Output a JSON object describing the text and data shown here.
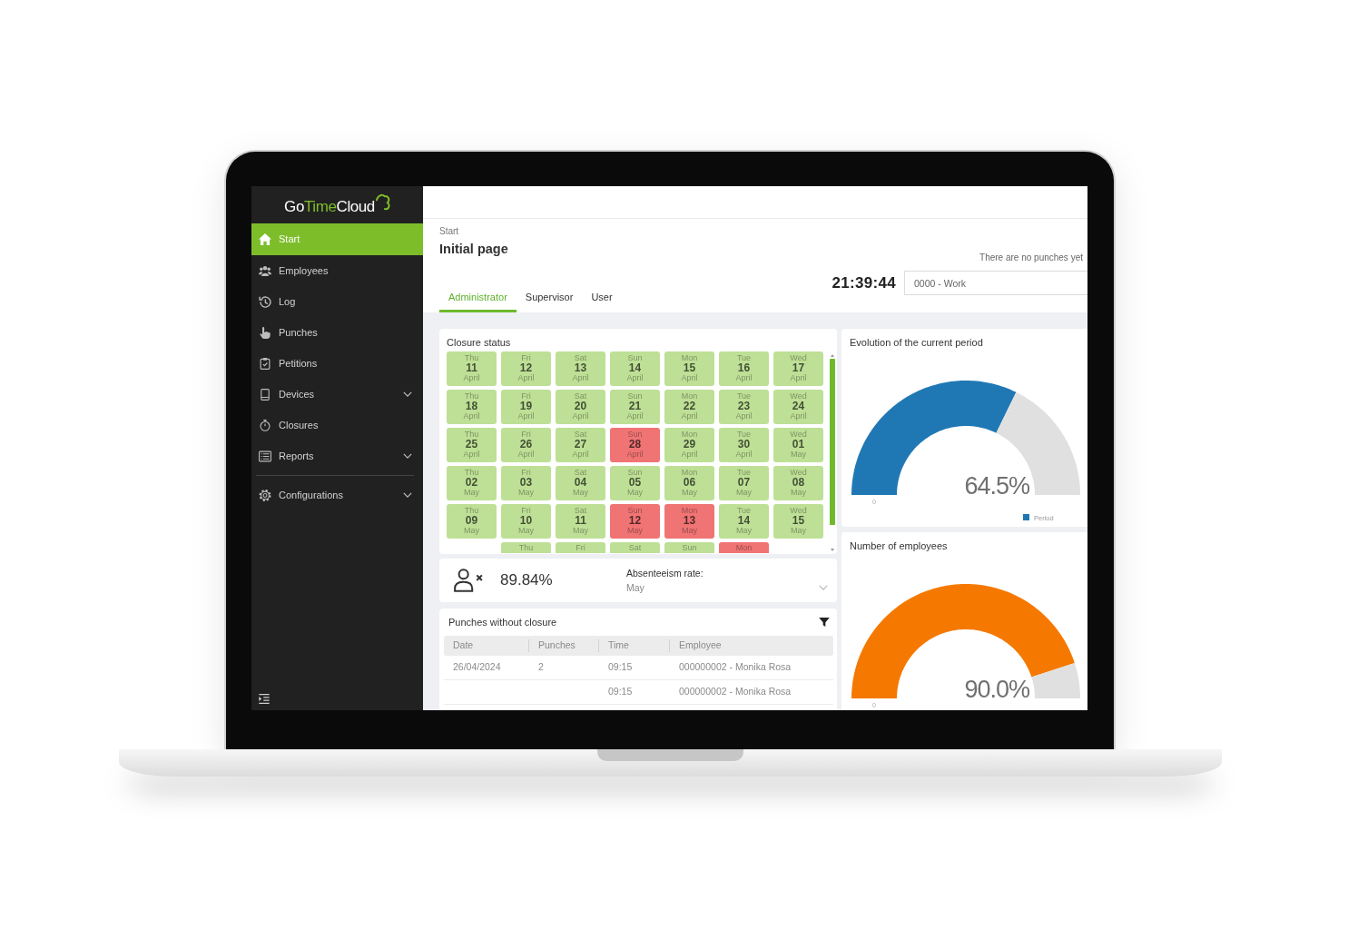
{
  "sidebar": {
    "logo": [
      {
        "text": "Go",
        "accent": false
      },
      {
        "text": "Time",
        "accent": true
      },
      {
        "text": "Cloud",
        "accent": false
      }
    ],
    "sections": [
      {
        "items": [
          {
            "label": "Start",
            "selected": true,
            "submenu": false
          },
          {
            "label": "Employees",
            "selected": false,
            "submenu": false
          },
          {
            "label": "Log",
            "selected": false,
            "submenu": false
          },
          {
            "label": "Punches",
            "selected": false,
            "submenu": false
          },
          {
            "label": "Petitions",
            "selected": false,
            "submenu": false
          },
          {
            "label": "Devices",
            "selected": false,
            "submenu": true
          },
          {
            "label": "Closures",
            "selected": false,
            "submenu": false
          },
          {
            "label": "Reports",
            "selected": false,
            "submenu": true
          }
        ]
      },
      {
        "items": [
          {
            "label": "Configurations",
            "selected": false,
            "submenu": true
          }
        ]
      }
    ]
  },
  "header": {
    "breadcrumb": "Start",
    "title": "Initial page",
    "punch_note": "There are no punches yet",
    "clock": "21:39:44",
    "activity_field": {
      "value": "0000 - Work"
    },
    "tabs": [
      {
        "label": "Administrator",
        "selected": true
      },
      {
        "label": "Supervisor",
        "selected": false
      },
      {
        "label": "User",
        "selected": false
      }
    ]
  },
  "closure_status": {
    "title": "Closure status",
    "days": [
      {
        "weekday": "Thu",
        "day": "11",
        "month": "April",
        "color": "#bee096"
      },
      {
        "weekday": "Fri",
        "day": "12",
        "month": "April",
        "color": "#bee096"
      },
      {
        "weekday": "Sat",
        "day": "13",
        "month": "April",
        "color": "#bee096"
      },
      {
        "weekday": "Sun",
        "day": "14",
        "month": "April",
        "color": "#bee096"
      },
      {
        "weekday": "Mon",
        "day": "15",
        "month": "April",
        "color": "#bee096"
      },
      {
        "weekday": "Tue",
        "day": "16",
        "month": "April",
        "color": "#bee096"
      },
      {
        "weekday": "Wed",
        "day": "17",
        "month": "April",
        "color": "#bee096"
      },
      {
        "weekday": "Thu",
        "day": "18",
        "month": "April",
        "color": "#bee096"
      },
      {
        "weekday": "Fri",
        "day": "19",
        "month": "April",
        "color": "#bee096"
      },
      {
        "weekday": "Sat",
        "day": "20",
        "month": "April",
        "color": "#bee096"
      },
      {
        "weekday": "Sun",
        "day": "21",
        "month": "April",
        "color": "#bee096"
      },
      {
        "weekday": "Mon",
        "day": "22",
        "month": "April",
        "color": "#bee096"
      },
      {
        "weekday": "Tue",
        "day": "23",
        "month": "April",
        "color": "#bee096"
      },
      {
        "weekday": "Wed",
        "day": "24",
        "month": "April",
        "color": "#bee096"
      },
      {
        "weekday": "Thu",
        "day": "25",
        "month": "April",
        "color": "#bee096"
      },
      {
        "weekday": "Fri",
        "day": "26",
        "month": "April",
        "color": "#bee096"
      },
      {
        "weekday": "Sat",
        "day": "27",
        "month": "April",
        "color": "#bee096"
      },
      {
        "weekday": "Sun",
        "day": "28",
        "month": "April",
        "color": "#f07474"
      },
      {
        "weekday": "Mon",
        "day": "29",
        "month": "April",
        "color": "#bee096"
      },
      {
        "weekday": "Tue",
        "day": "30",
        "month": "April",
        "color": "#bee096"
      },
      {
        "weekday": "Wed",
        "day": "01",
        "month": "May",
        "color": "#bee096"
      },
      {
        "weekday": "Thu",
        "day": "02",
        "month": "May",
        "color": "#bee096"
      },
      {
        "weekday": "Fri",
        "day": "03",
        "month": "May",
        "color": "#bee096"
      },
      {
        "weekday": "Sat",
        "day": "04",
        "month": "May",
        "color": "#bee096"
      },
      {
        "weekday": "Sun",
        "day": "05",
        "month": "May",
        "color": "#bee096"
      },
      {
        "weekday": "Mon",
        "day": "06",
        "month": "May",
        "color": "#bee096"
      },
      {
        "weekday": "Tue",
        "day": "07",
        "month": "May",
        "color": "#bee096"
      },
      {
        "weekday": "Wed",
        "day": "08",
        "month": "May",
        "color": "#bee096"
      },
      {
        "weekday": "Thu",
        "day": "09",
        "month": "May",
        "color": "#bee096"
      },
      {
        "weekday": "Fri",
        "day": "10",
        "month": "May",
        "color": "#bee096"
      },
      {
        "weekday": "Sat",
        "day": "11",
        "month": "May",
        "color": "#bee096"
      },
      {
        "weekday": "Sun",
        "day": "12",
        "month": "May",
        "color": "#f07474"
      },
      {
        "weekday": "Mon",
        "day": "13",
        "month": "May",
        "color": "#f07474"
      },
      {
        "weekday": "Tue",
        "day": "14",
        "month": "May",
        "color": "#bee096"
      },
      {
        "weekday": "Wed",
        "day": "15",
        "month": "May",
        "color": "#bee096"
      },
      {
        "weekday": "Thu",
        "color": "#bee096"
      },
      {
        "weekday": "Fri",
        "color": "#bee096"
      },
      {
        "weekday": "Sat",
        "color": "#bee096"
      },
      {
        "weekday": "Sun",
        "color": "#bee096"
      },
      {
        "weekday": "Mon",
        "color": "#f07474"
      }
    ]
  },
  "absenteeism": {
    "rate": "89.84%",
    "label": "Absenteeism rate:",
    "period_select": {
      "value": "May"
    }
  },
  "punches_without_closure": {
    "title": "Punches without closure",
    "columns": [
      "Date",
      "Punches",
      "Time",
      "Employee"
    ],
    "rows": [
      {
        "date": "26/04/2024",
        "punches": "2",
        "time": "09:15",
        "employee": "000000002 - Monika Rosa"
      },
      {
        "time": "09:15",
        "employee": "000000002 - Monika Rosa"
      }
    ]
  },
  "gauges": [
    {
      "color": "#1f78b4",
      "reading": "64.5%",
      "scale_label": "0",
      "legend": "Period",
      "chart_data": {
        "type": "donut",
        "title": "Evolution of the current period",
        "values": [
          64.5,
          35.5
        ]
      }
    },
    {
      "color": "#f57900",
      "reading": "90.0%",
      "scale_label": "0",
      "chart_data": {
        "type": "donut",
        "title": "Number of employees",
        "values": [
          90.0,
          10.0
        ]
      }
    }
  ]
}
